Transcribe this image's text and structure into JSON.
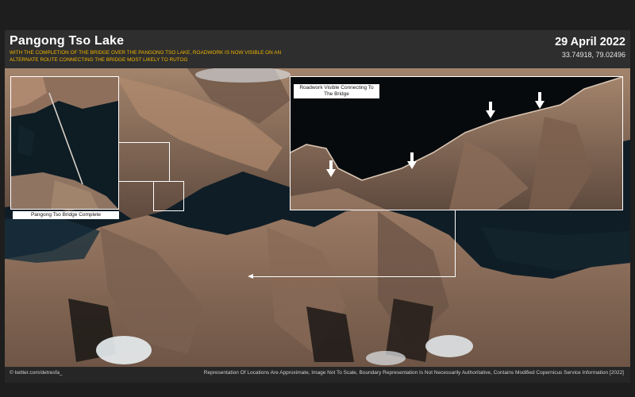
{
  "header": {
    "title": "Pangong Tso Lake",
    "subtitle": "WITH THE COMPLETION OF THE BRIDGE OVER THE PANGONG TSO LAKE, ROADWORK IS NOW VISIBLE ON AN ALTERNATE ROUTE CONNECTING THE BRIDGE MOST LIKELY TO RUTOG",
    "date": "29 April 2022",
    "coordinates": "33.74918, 79.02496"
  },
  "insets": {
    "bridge_label": "Pangong Tso Bridge Complete",
    "roadwork_label": "Roadwork Visible Connecting To The Bridge"
  },
  "footer": {
    "credit": "© twitter.com/detresfa_",
    "disclaimer": "Representation Of Locations Are Approximate, Image Not To Scale, Boundary Representation Is Not Necessarily Authoritative, Contains Modified Copernicus Service Information [2022]"
  },
  "colors": {
    "title": "#ffffff",
    "subtitle": "#f0b400",
    "lake": "#0d1a22",
    "terrain": "#8a6a55",
    "annotation": "#ffffff"
  },
  "icons": {
    "roadwork_markers": "down-arrow-icon"
  }
}
